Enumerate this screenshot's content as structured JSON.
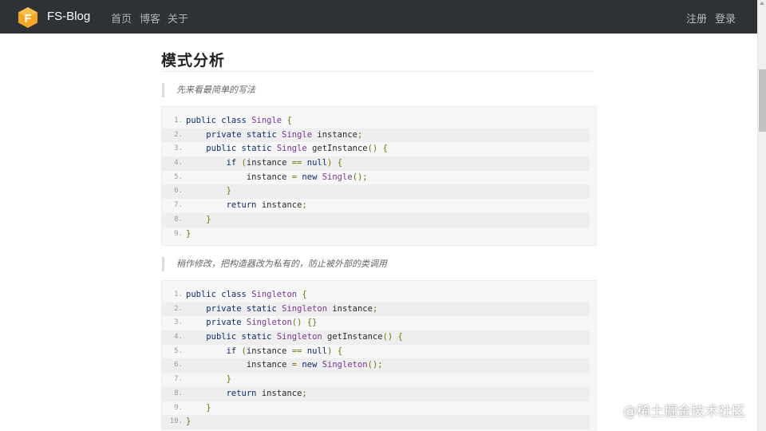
{
  "nav": {
    "brand": "FS-Blog",
    "logo_letter": "F",
    "links": [
      "首页",
      "博客",
      "关于"
    ],
    "right_links": [
      "注册",
      "登录"
    ]
  },
  "article": {
    "section_title": "模式分析",
    "quote1": "先来看最简单的写法",
    "quote2": "稍作修改，把构造器改为私有的，防止被外部的类调用",
    "code1": [
      {
        "n": "1.",
        "t": [
          [
            "kw",
            "public class "
          ],
          [
            "ty",
            "Single"
          ],
          [
            "pn",
            " {"
          ]
        ]
      },
      {
        "n": "2.",
        "t": [
          [
            "nm",
            "    "
          ],
          [
            "kw",
            "private static "
          ],
          [
            "ty",
            "Single"
          ],
          [
            "nm",
            " instance"
          ],
          [
            "pn",
            ";"
          ]
        ]
      },
      {
        "n": "3.",
        "t": [
          [
            "nm",
            "    "
          ],
          [
            "kw",
            "public static "
          ],
          [
            "ty",
            "Single"
          ],
          [
            "nm",
            " getInstance"
          ],
          [
            "pn",
            "() {"
          ]
        ]
      },
      {
        "n": "4.",
        "t": [
          [
            "nm",
            "        "
          ],
          [
            "kw",
            "if "
          ],
          [
            "pn",
            "("
          ],
          [
            "nm",
            "instance "
          ],
          [
            "pn",
            "== "
          ],
          [
            "kw",
            "null"
          ],
          [
            "pn",
            ") {"
          ]
        ]
      },
      {
        "n": "5.",
        "t": [
          [
            "nm",
            "            instance "
          ],
          [
            "pn",
            "= "
          ],
          [
            "kw",
            "new "
          ],
          [
            "ty",
            "Single"
          ],
          [
            "pn",
            "();"
          ]
        ]
      },
      {
        "n": "6.",
        "t": [
          [
            "nm",
            "        "
          ],
          [
            "pn",
            "}"
          ]
        ]
      },
      {
        "n": "7.",
        "t": [
          [
            "nm",
            "        "
          ],
          [
            "kw",
            "return "
          ],
          [
            "nm",
            "instance"
          ],
          [
            "pn",
            ";"
          ]
        ]
      },
      {
        "n": "8.",
        "t": [
          [
            "nm",
            "    "
          ],
          [
            "pn",
            "}"
          ]
        ]
      },
      {
        "n": "9.",
        "t": [
          [
            "pn",
            "}"
          ]
        ]
      }
    ],
    "code2": [
      {
        "n": "1.",
        "t": [
          [
            "kw",
            "public class "
          ],
          [
            "ty",
            "Singleton"
          ],
          [
            "pn",
            " {"
          ]
        ]
      },
      {
        "n": "2.",
        "t": [
          [
            "nm",
            "    "
          ],
          [
            "kw",
            "private static "
          ],
          [
            "ty",
            "Singleton"
          ],
          [
            "nm",
            " instance"
          ],
          [
            "pn",
            ";"
          ]
        ]
      },
      {
        "n": "3.",
        "t": [
          [
            "nm",
            "    "
          ],
          [
            "kw",
            "private "
          ],
          [
            "ty",
            "Singleton"
          ],
          [
            "pn",
            "() {}"
          ]
        ]
      },
      {
        "n": "4.",
        "t": [
          [
            "nm",
            "    "
          ],
          [
            "kw",
            "public static "
          ],
          [
            "ty",
            "Singleton"
          ],
          [
            "nm",
            " getInstance"
          ],
          [
            "pn",
            "() {"
          ]
        ]
      },
      {
        "n": "5.",
        "t": [
          [
            "nm",
            "        "
          ],
          [
            "kw",
            "if "
          ],
          [
            "pn",
            "("
          ],
          [
            "nm",
            "instance "
          ],
          [
            "pn",
            "== "
          ],
          [
            "kw",
            "null"
          ],
          [
            "pn",
            ") {"
          ]
        ]
      },
      {
        "n": "6.",
        "t": [
          [
            "nm",
            "            instance "
          ],
          [
            "pn",
            "= "
          ],
          [
            "kw",
            "new "
          ],
          [
            "ty",
            "Singleton"
          ],
          [
            "pn",
            "();"
          ]
        ]
      },
      {
        "n": "7.",
        "t": [
          [
            "nm",
            "        "
          ],
          [
            "pn",
            "}"
          ]
        ]
      },
      {
        "n": "8.",
        "t": [
          [
            "nm",
            "        "
          ],
          [
            "kw",
            "return "
          ],
          [
            "nm",
            "instance"
          ],
          [
            "pn",
            ";"
          ]
        ]
      },
      {
        "n": "9.",
        "t": [
          [
            "nm",
            "    "
          ],
          [
            "pn",
            "}"
          ]
        ]
      },
      {
        "n": "10.",
        "t": [
          [
            "pn",
            "}"
          ]
        ]
      }
    ]
  },
  "watermark": "@稀土掘金技术社区",
  "colors": {
    "navbar_bg": "#2e3135",
    "logo_orange": "#f5a623",
    "keyword": "#0c2b6e",
    "type": "#7a3490",
    "punct": "#6b7800"
  }
}
